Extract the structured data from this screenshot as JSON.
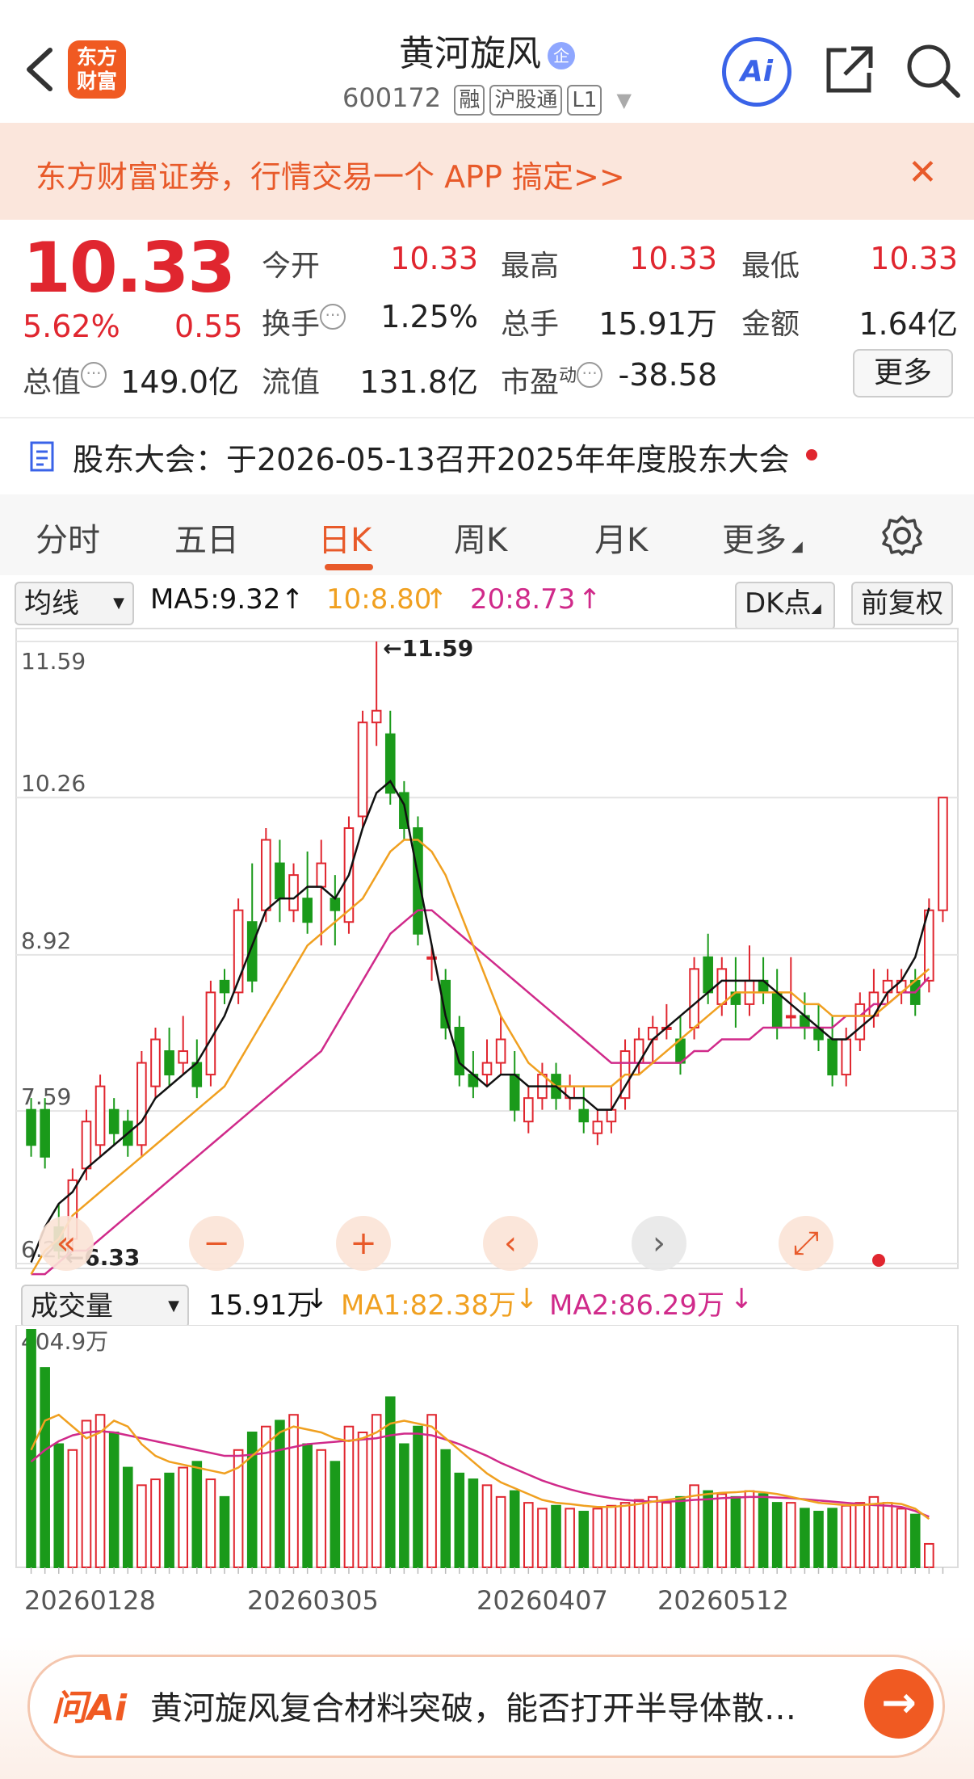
{
  "header": {
    "logo_text_line1": "东方",
    "logo_text_line2": "财富",
    "stock_name": "黄河旋风",
    "badge": "企",
    "code": "600172",
    "tags": [
      "融",
      "沪股通",
      "L1"
    ],
    "ai_label": "Ai"
  },
  "banner": {
    "text": "东方财富证券，行情交易一个 APP 搞定>>",
    "close": "✕"
  },
  "quote": {
    "price": "10.33",
    "change_pct": "5.62%",
    "change": "0.55",
    "open_label": "今开",
    "open": "10.33",
    "high_label": "最高",
    "high": "10.33",
    "low_label": "最低",
    "low": "10.33",
    "turnover_label": "换手",
    "turnover": "1.25%",
    "volume_label": "总手",
    "volume": "15.91万",
    "amount_label": "金额",
    "amount": "1.64亿",
    "mktcap_label": "总值",
    "mktcap": "149.0亿",
    "float_label": "流值",
    "float": "131.8亿",
    "pe_label": "市盈",
    "pe_sup": "动",
    "pe": "-38.58",
    "more": "更多"
  },
  "notice": {
    "text": "股东大会：于2026-05-13召开2025年年度股东大会"
  },
  "tabs": [
    "分时",
    "五日",
    "日K",
    "周K",
    "月K",
    "更多"
  ],
  "active_tab": 2,
  "ma_legend": {
    "selector": "均线",
    "ma5": "MA5:9.32",
    "ma10": "10:8.80",
    "ma20": "20:8.73",
    "dk": "DK点",
    "adjust": "前复权"
  },
  "volume_legend": {
    "selector": "成交量",
    "vol": "15.91万",
    "ma1": "MA1:82.38万",
    "ma2": "MA2:86.29万"
  },
  "colors": {
    "up": "#e0262f",
    "down": "#1a9a1a",
    "ma5": "#111111",
    "ma10": "#f0a020",
    "ma20": "#d02a8a",
    "accent": "#f05a22"
  },
  "chart_data": {
    "type": "candlestick",
    "y_ticks": [
      "11.59",
      "10.26",
      "8.92",
      "7.59",
      "6.29"
    ],
    "ylim": [
      6.29,
      11.59
    ],
    "max_label": "11.59",
    "min_label": "6.33",
    "x_labels": [
      "20260128",
      "20260305",
      "20260407",
      "20260512"
    ],
    "vol_max_label": "404.9万",
    "candles": [
      {
        "o": 7.6,
        "h": 7.7,
        "l": 7.2,
        "c": 7.3
      },
      {
        "o": 7.6,
        "h": 7.7,
        "l": 7.1,
        "c": 7.2
      },
      {
        "o": 6.6,
        "h": 6.8,
        "l": 6.33,
        "c": 6.4
      },
      {
        "o": 6.5,
        "h": 7.1,
        "l": 6.4,
        "c": 7.0
      },
      {
        "o": 7.1,
        "h": 7.6,
        "l": 7.0,
        "c": 7.5
      },
      {
        "o": 7.3,
        "h": 7.9,
        "l": 7.2,
        "c": 7.8
      },
      {
        "o": 7.6,
        "h": 7.7,
        "l": 7.3,
        "c": 7.4
      },
      {
        "o": 7.5,
        "h": 7.6,
        "l": 7.2,
        "c": 7.3
      },
      {
        "o": 7.3,
        "h": 8.1,
        "l": 7.2,
        "c": 8.0
      },
      {
        "o": 7.8,
        "h": 8.3,
        "l": 7.7,
        "c": 8.2
      },
      {
        "o": 8.1,
        "h": 8.3,
        "l": 7.8,
        "c": 7.9
      },
      {
        "o": 8.0,
        "h": 8.4,
        "l": 7.9,
        "c": 8.1
      },
      {
        "o": 8.0,
        "h": 8.2,
        "l": 7.7,
        "c": 7.8
      },
      {
        "o": 7.9,
        "h": 8.7,
        "l": 7.8,
        "c": 8.6
      },
      {
        "o": 8.7,
        "h": 8.8,
        "l": 8.5,
        "c": 8.6
      },
      {
        "o": 8.6,
        "h": 9.4,
        "l": 8.5,
        "c": 9.3
      },
      {
        "o": 9.2,
        "h": 9.7,
        "l": 8.6,
        "c": 8.7
      },
      {
        "o": 9.3,
        "h": 10.0,
        "l": 9.2,
        "c": 9.9
      },
      {
        "o": 9.7,
        "h": 9.9,
        "l": 9.2,
        "c": 9.4
      },
      {
        "o": 9.3,
        "h": 9.7,
        "l": 9.2,
        "c": 9.6
      },
      {
        "o": 9.4,
        "h": 9.8,
        "l": 9.1,
        "c": 9.2
      },
      {
        "o": 9.5,
        "h": 9.9,
        "l": 9.0,
        "c": 9.7
      },
      {
        "o": 9.4,
        "h": 9.6,
        "l": 9.0,
        "c": 9.3
      },
      {
        "o": 9.2,
        "h": 10.1,
        "l": 9.1,
        "c": 10.0
      },
      {
        "o": 10.1,
        "h": 11.0,
        "l": 10.0,
        "c": 10.9
      },
      {
        "o": 10.9,
        "h": 11.59,
        "l": 10.7,
        "c": 11.0
      },
      {
        "o": 10.8,
        "h": 11.0,
        "l": 10.2,
        "c": 10.3
      },
      {
        "o": 10.3,
        "h": 10.4,
        "l": 9.9,
        "c": 10.0
      },
      {
        "o": 10.0,
        "h": 10.1,
        "l": 9.0,
        "c": 9.1
      },
      {
        "o": 8.9,
        "h": 9.0,
        "l": 8.7,
        "c": 8.9
      },
      {
        "o": 8.7,
        "h": 8.8,
        "l": 8.2,
        "c": 8.3
      },
      {
        "o": 8.3,
        "h": 8.4,
        "l": 7.8,
        "c": 7.9
      },
      {
        "o": 7.9,
        "h": 8.1,
        "l": 7.7,
        "c": 7.8
      },
      {
        "o": 7.9,
        "h": 8.2,
        "l": 7.8,
        "c": 8.0
      },
      {
        "o": 8.0,
        "h": 8.4,
        "l": 7.9,
        "c": 8.2
      },
      {
        "o": 7.9,
        "h": 8.1,
        "l": 7.5,
        "c": 7.6
      },
      {
        "o": 7.5,
        "h": 7.8,
        "l": 7.4,
        "c": 7.7
      },
      {
        "o": 7.7,
        "h": 8.0,
        "l": 7.6,
        "c": 7.9
      },
      {
        "o": 7.9,
        "h": 8.0,
        "l": 7.6,
        "c": 7.7
      },
      {
        "o": 7.7,
        "h": 7.9,
        "l": 7.6,
        "c": 7.8
      },
      {
        "o": 7.6,
        "h": 7.8,
        "l": 7.4,
        "c": 7.5
      },
      {
        "o": 7.4,
        "h": 7.6,
        "l": 7.3,
        "c": 7.5
      },
      {
        "o": 7.5,
        "h": 7.8,
        "l": 7.4,
        "c": 7.6
      },
      {
        "o": 7.7,
        "h": 8.2,
        "l": 7.6,
        "c": 8.1
      },
      {
        "o": 8.0,
        "h": 8.3,
        "l": 7.9,
        "c": 8.2
      },
      {
        "o": 8.2,
        "h": 8.4,
        "l": 8.0,
        "c": 8.3
      },
      {
        "o": 8.3,
        "h": 8.5,
        "l": 8.2,
        "c": 8.3
      },
      {
        "o": 8.2,
        "h": 8.4,
        "l": 7.9,
        "c": 8.0
      },
      {
        "o": 8.3,
        "h": 8.9,
        "l": 8.2,
        "c": 8.8
      },
      {
        "o": 8.9,
        "h": 9.1,
        "l": 8.5,
        "c": 8.6
      },
      {
        "o": 8.5,
        "h": 8.9,
        "l": 8.4,
        "c": 8.8
      },
      {
        "o": 8.6,
        "h": 8.9,
        "l": 8.3,
        "c": 8.5
      },
      {
        "o": 8.5,
        "h": 9.0,
        "l": 8.4,
        "c": 8.7
      },
      {
        "o": 8.7,
        "h": 8.9,
        "l": 8.5,
        "c": 8.6
      },
      {
        "o": 8.6,
        "h": 8.8,
        "l": 8.2,
        "c": 8.3
      },
      {
        "o": 8.4,
        "h": 8.9,
        "l": 8.3,
        "c": 8.4
      },
      {
        "o": 8.4,
        "h": 8.6,
        "l": 8.2,
        "c": 8.3
      },
      {
        "o": 8.3,
        "h": 8.5,
        "l": 8.1,
        "c": 8.2
      },
      {
        "o": 8.2,
        "h": 8.4,
        "l": 7.8,
        "c": 7.9
      },
      {
        "o": 7.9,
        "h": 8.3,
        "l": 7.8,
        "c": 8.2
      },
      {
        "o": 8.2,
        "h": 8.6,
        "l": 8.1,
        "c": 8.5
      },
      {
        "o": 8.4,
        "h": 8.8,
        "l": 8.3,
        "c": 8.6
      },
      {
        "o": 8.6,
        "h": 8.8,
        "l": 8.5,
        "c": 8.7
      },
      {
        "o": 8.6,
        "h": 8.8,
        "l": 8.5,
        "c": 8.7
      },
      {
        "o": 8.7,
        "h": 8.8,
        "l": 8.4,
        "c": 8.5
      },
      {
        "o": 8.7,
        "h": 9.4,
        "l": 8.6,
        "c": 9.3
      },
      {
        "o": 9.3,
        "h": 10.26,
        "l": 9.2,
        "c": 10.26
      }
    ],
    "ma5": [
      6.3,
      6.6,
      6.8,
      6.9,
      7.1,
      7.2,
      7.3,
      7.4,
      7.5,
      7.7,
      7.8,
      7.9,
      8.0,
      8.2,
      8.4,
      8.7,
      9.0,
      9.3,
      9.4,
      9.4,
      9.5,
      9.5,
      9.4,
      9.6,
      10.0,
      10.3,
      10.4,
      10.2,
      9.6,
      9.0,
      8.4,
      8.0,
      7.9,
      7.8,
      7.9,
      7.9,
      7.8,
      7.8,
      7.8,
      7.7,
      7.7,
      7.6,
      7.6,
      7.8,
      8.0,
      8.2,
      8.3,
      8.4,
      8.5,
      8.6,
      8.7,
      8.7,
      8.7,
      8.7,
      8.6,
      8.5,
      8.4,
      8.3,
      8.2,
      8.2,
      8.3,
      8.4,
      8.6,
      8.7,
      8.9,
      9.32
    ],
    "ma10": [
      6.2,
      6.4,
      6.5,
      6.7,
      6.8,
      6.9,
      7.0,
      7.1,
      7.2,
      7.3,
      7.4,
      7.5,
      7.6,
      7.7,
      7.8,
      8.0,
      8.2,
      8.4,
      8.6,
      8.8,
      9.0,
      9.1,
      9.2,
      9.3,
      9.4,
      9.6,
      9.8,
      9.9,
      9.9,
      9.8,
      9.6,
      9.3,
      9.0,
      8.7,
      8.4,
      8.2,
      8.0,
      7.9,
      7.8,
      7.8,
      7.8,
      7.8,
      7.8,
      7.9,
      7.9,
      8.0,
      8.1,
      8.2,
      8.3,
      8.4,
      8.5,
      8.6,
      8.6,
      8.6,
      8.6,
      8.6,
      8.5,
      8.5,
      8.4,
      8.4,
      8.4,
      8.4,
      8.5,
      8.6,
      8.7,
      8.8
    ],
    "ma20": [
      6.2,
      6.2,
      6.3,
      6.4,
      6.4,
      6.5,
      6.6,
      6.7,
      6.8,
      6.9,
      7.0,
      7.1,
      7.2,
      7.3,
      7.4,
      7.5,
      7.6,
      7.7,
      7.8,
      7.9,
      8.0,
      8.1,
      8.3,
      8.5,
      8.7,
      8.9,
      9.1,
      9.2,
      9.3,
      9.3,
      9.2,
      9.1,
      9.0,
      8.9,
      8.8,
      8.7,
      8.6,
      8.5,
      8.4,
      8.3,
      8.2,
      8.1,
      8.0,
      8.0,
      8.0,
      8.0,
      8.0,
      8.0,
      8.1,
      8.1,
      8.2,
      8.2,
      8.2,
      8.3,
      8.3,
      8.3,
      8.3,
      8.3,
      8.3,
      8.4,
      8.4,
      8.5,
      8.5,
      8.6,
      8.6,
      8.73
    ],
    "volume": [
      404.9,
      340,
      210,
      200,
      250,
      260,
      230,
      170,
      140,
      150,
      160,
      170,
      180,
      150,
      120,
      200,
      230,
      240,
      250,
      260,
      210,
      200,
      180,
      240,
      230,
      260,
      290,
      210,
      240,
      260,
      200,
      160,
      150,
      140,
      120,
      130,
      110,
      100,
      105,
      100,
      95,
      100,
      105,
      110,
      115,
      120,
      110,
      120,
      140,
      130,
      125,
      120,
      130,
      125,
      110,
      110,
      100,
      95,
      100,
      105,
      110,
      120,
      110,
      100,
      90,
      40
    ],
    "vol_ma1": [
      200,
      250,
      260,
      240,
      220,
      230,
      250,
      240,
      210,
      190,
      180,
      175,
      170,
      165,
      160,
      170,
      190,
      210,
      230,
      240,
      235,
      230,
      220,
      215,
      220,
      230,
      245,
      250,
      245,
      240,
      220,
      200,
      180,
      160,
      145,
      135,
      125,
      115,
      110,
      108,
      105,
      103,
      103,
      105,
      108,
      112,
      115,
      118,
      122,
      125,
      127,
      128,
      130,
      128,
      125,
      120,
      115,
      110,
      108,
      106,
      106,
      108,
      110,
      108,
      100,
      82.38
    ],
    "vol_ma2": [
      180,
      200,
      215,
      225,
      230,
      232,
      230,
      225,
      220,
      215,
      210,
      205,
      200,
      195,
      190,
      190,
      192,
      195,
      200,
      205,
      210,
      212,
      214,
      216,
      218,
      220,
      225,
      228,
      228,
      225,
      218,
      210,
      200,
      190,
      178,
      168,
      158,
      148,
      140,
      133,
      127,
      122,
      118,
      115,
      113,
      112,
      112,
      113,
      115,
      116,
      118,
      119,
      120,
      120,
      119,
      118,
      116,
      114,
      112,
      110,
      108,
      106,
      105,
      103,
      96,
      86.29
    ]
  },
  "bottom_bar": {
    "logo": "问Ai",
    "text": "黄河旋风复合材料突破，能否打开半导体散…"
  }
}
